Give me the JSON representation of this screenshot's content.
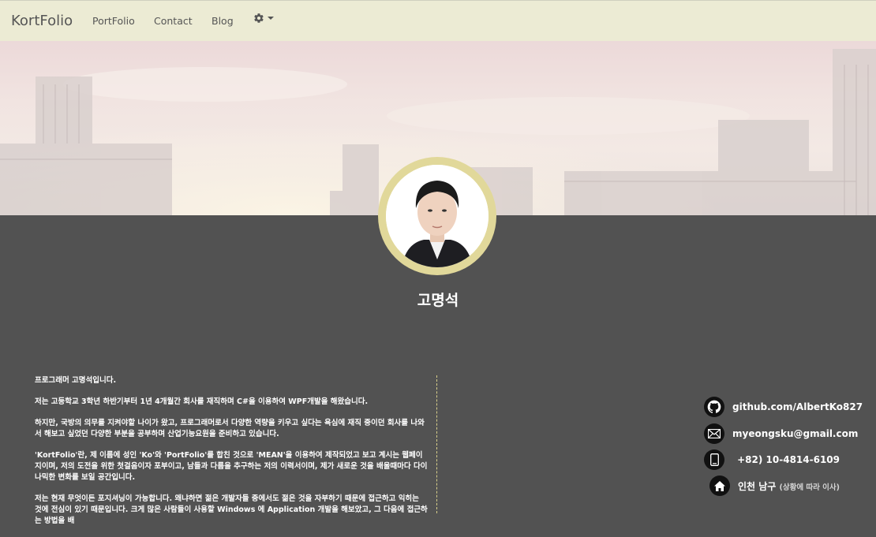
{
  "navbar": {
    "brand": "KortFolio",
    "links": [
      "PortFolio",
      "Contact",
      "Blog"
    ],
    "settings_icon": "gear-icon"
  },
  "profile": {
    "name": "고명석"
  },
  "about": {
    "paragraphs": [
      "프로그래머 고명석입니다.",
      "저는 고등학교 3학년 하반기부터 1년 4개월간 회사를 재직하며 C#을 이용하여 WPF개발을 해왔습니다.",
      "하지만, 국방의 의무를 지켜야할 나이가 왔고, 프로그래머로서 다양한 역량을 키우고 싶다는 욕심에 재직 중이던 회사를 나와서 해보고 싶었던 다양한 부분을 공부하며 산업기능요원을 준비하고 있습니다.",
      "'KortFolio'란, 제 이름에 성인 'Ko'와 'PortFolio'를 합친 것으로 'MEAN'을 이용하여 제작되었고 보고 계시는 웹페이지이며, 저의 도전을 위한 첫걸음이자 포부이고, 남들과 다름을 추구하는 저의 이력서이며, 제가 새로운 것을 배울때마다 다이나믹한 변화를 보일 공간입니다.",
      "저는 현재 무엇이든 포지셔닝이 가능합니다. 왜냐하면 젊은 개발자들 중에서도 젊은 것을 자부하기 때문에 접근하고 익히는 것에 전심이 있기 때문입니다. 크게 많은 사람들이 사용할 Windows 에 Application 개발을 해보았고, 그 다음에 접근하는 방법을 배"
    ]
  },
  "contact": {
    "github": "github.com/AlbertKo827",
    "email": "myeongsku@gmail.com",
    "phone": "+82) 10-4814-6109",
    "address": "인천 남구",
    "address_note": "(상황에 따라 이사)"
  },
  "colors": {
    "navbar_bg": "#ecebd4",
    "page_bg": "#525252",
    "avatar_ring": "#e1d89a",
    "divider": "#d8cf8a"
  }
}
